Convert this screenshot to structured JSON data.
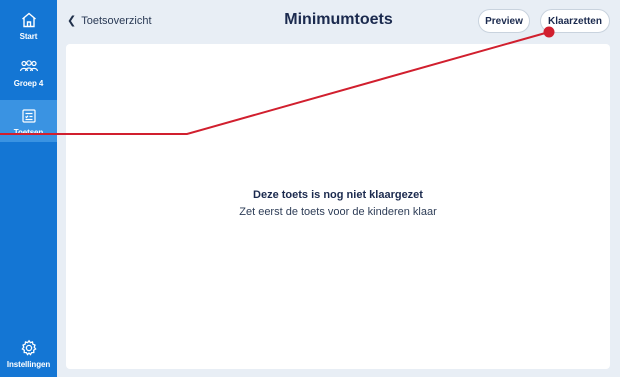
{
  "sidebar": {
    "items": [
      {
        "label": "Start",
        "icon": "home-icon"
      },
      {
        "label": "Groep 4",
        "icon": "group-icon"
      },
      {
        "label": "Toetsen",
        "icon": "test-icon",
        "active": true
      },
      {
        "label": "Instellingen",
        "icon": "gear-icon"
      }
    ]
  },
  "header": {
    "back_label": "Toetsoverzicht",
    "title": "Minimumtoets",
    "preview_label": "Preview",
    "klaarzetten_label": "Klaarzetten"
  },
  "main": {
    "empty_title": "Deze toets is nog niet klaargezet",
    "empty_subtitle": "Zet eerst de toets voor de kinderen klaar"
  },
  "annotation": {
    "color": "#d11f2e"
  },
  "colors": {
    "sidebar": "#1476d4",
    "sidebar_active": "#3a93e2",
    "background": "#e8eef5",
    "text_dark": "#1b2a4e"
  }
}
